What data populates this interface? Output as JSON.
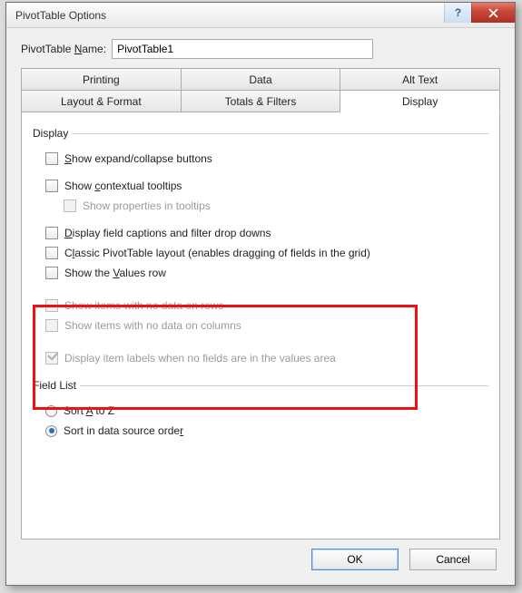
{
  "window": {
    "title": "PivotTable Options"
  },
  "nameRow": {
    "label_pre": "PivotTable ",
    "label_u": "N",
    "label_post": "ame:",
    "value": "PivotTable1"
  },
  "tabs": {
    "row1": [
      "Printing",
      "Data",
      "Alt Text"
    ],
    "row2": [
      "Layout & Format",
      "Totals & Filters",
      "Display"
    ],
    "active": "Display"
  },
  "groups": {
    "display": {
      "legend": "Display",
      "items": [
        {
          "key": "expand",
          "pre": "",
          "u": "S",
          "post": "how expand/collapse buttons",
          "checked": false,
          "disabled": false,
          "indent": false
        },
        {
          "key": "ctx",
          "pre": "Show ",
          "u": "c",
          "post": "ontextual tooltips",
          "checked": false,
          "disabled": false,
          "indent": false
        },
        {
          "key": "prop",
          "pre": "Show properties in tooltips",
          "u": "",
          "post": "",
          "checked": false,
          "disabled": true,
          "indent": true
        },
        {
          "key": "caps",
          "pre": "",
          "u": "D",
          "post": "isplay field captions and filter drop downs",
          "checked": false,
          "disabled": false,
          "indent": false
        },
        {
          "key": "classic",
          "pre": "C",
          "u": "l",
          "post": "assic PivotTable layout (enables dragging of fields in the grid)",
          "checked": false,
          "disabled": false,
          "indent": false
        },
        {
          "key": "values",
          "pre": "Show the ",
          "u": "V",
          "post": "alues row",
          "checked": false,
          "disabled": false,
          "indent": false
        },
        {
          "key": "norows",
          "pre": "Show items with no data on rows",
          "u": "",
          "post": "",
          "checked": false,
          "disabled": true,
          "indent": false
        },
        {
          "key": "nocols",
          "pre": "Show items with no data on columns",
          "u": "",
          "post": "",
          "checked": false,
          "disabled": true,
          "indent": false
        },
        {
          "key": "labels",
          "pre": "Display item labels when no fields are in the values area",
          "u": "",
          "post": "",
          "checked": true,
          "disabled": true,
          "indent": false
        }
      ]
    },
    "fieldlist": {
      "legend": "Field List",
      "items": [
        {
          "key": "atoz",
          "pre": "Sort ",
          "u": "A",
          "post": " to Z",
          "selected": false
        },
        {
          "key": "src",
          "pre": "Sort in data source orde",
          "u": "r",
          "post": "",
          "selected": true
        }
      ]
    }
  },
  "buttons": {
    "ok": "OK",
    "cancel": "Cancel"
  }
}
